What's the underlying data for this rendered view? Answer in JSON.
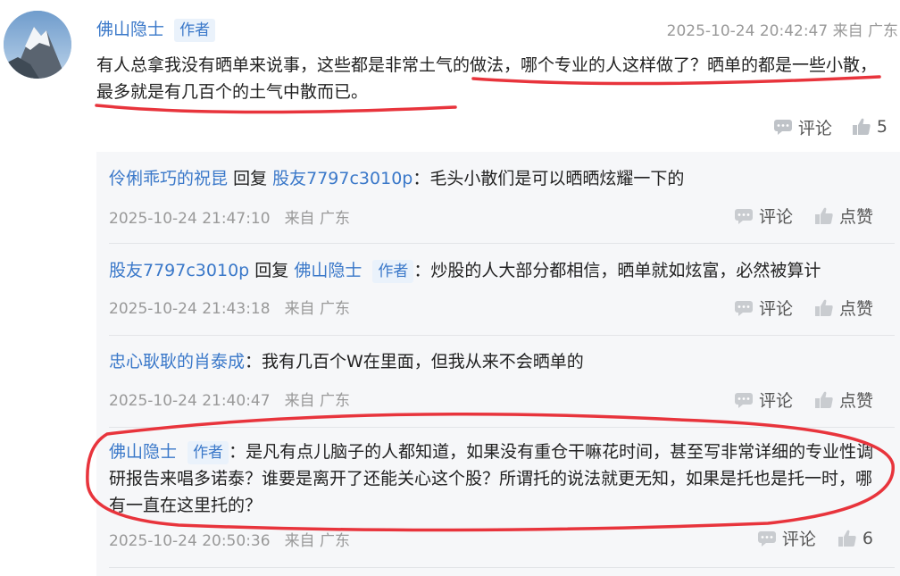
{
  "main_comment": {
    "username": "佛山隐士",
    "badge": "作者",
    "time": "2025-10-24 20:42:47 来自 广东",
    "text": "有人总拿我没有晒单来说事，这些都是非常土气的做法，哪个专业的人这样做了？晒单的都是一些小散，最多就是有几百个的土气中散而已。",
    "comment_label": "评论",
    "likes": "5"
  },
  "replies": [
    {
      "author": "伶俐乖巧的祝昆",
      "reply_word": "回复",
      "target": "股友7797c3010p",
      "text": "：毛头小散们是可以晒晒炫耀一下的",
      "time": "2025-10-24 21:47:10",
      "location": "来自 广东",
      "comment_label": "评论",
      "like_label": "点赞"
    },
    {
      "author": "股友7797c3010p",
      "reply_word": "回复",
      "target": "佛山隐士",
      "target_badge": "作者",
      "text": "：炒股的人大部分都相信，晒单就如炫富，必然被算计",
      "time": "2025-10-24 21:43:18",
      "location": "来自 广东",
      "comment_label": "评论",
      "like_label": "点赞"
    },
    {
      "author": "忠心耿耿的肖泰成",
      "text": "：我有几百个W在里面，但我从来不会晒单的",
      "time": "2025-10-24 21:40:47",
      "location": "来自 广东",
      "comment_label": "评论",
      "like_label": "点赞"
    },
    {
      "author": "佛山隐士",
      "author_badge": "作者",
      "text": "：是凡有点儿脑子的人都知道，如果没有重仓干嘛花时间，甚至写非常详细的专业性调研报告来唱多诺泰？谁要是离开了还能关心这个股？所谓托的说法就更无知，如果是托也是托一时，哪有一直在这里托的？",
      "time": "2025-10-24 20:50:36",
      "location": "来自 广东",
      "comment_label": "评论",
      "likes": "6"
    }
  ],
  "colors": {
    "link": "#3a78c9",
    "annotation": "#e8343c",
    "meta": "#999999"
  }
}
